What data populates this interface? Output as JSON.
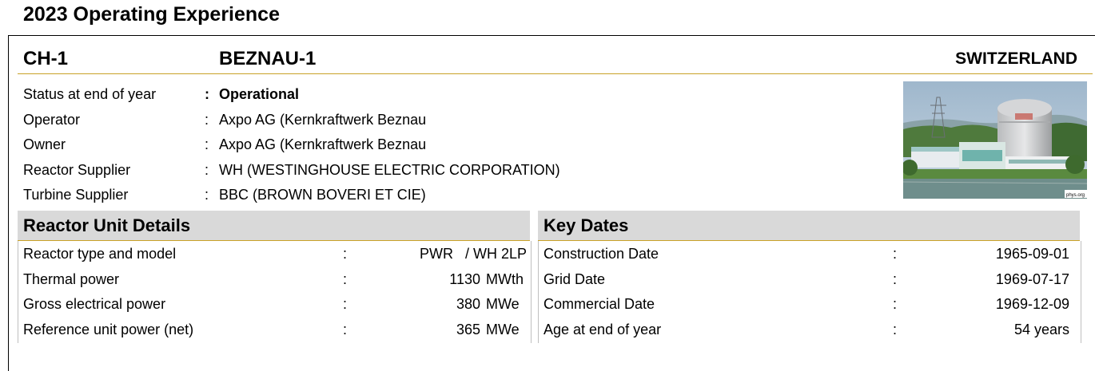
{
  "report_title": "2023 Operating Experience",
  "unit": {
    "code": "CH-1",
    "name": "BEZNAU-1",
    "country": "SWITZERLAND"
  },
  "info": [
    {
      "label": "Status at end of year",
      "value": "Operational",
      "bold": true
    },
    {
      "label": "Operator",
      "value": "Axpo AG (Kernkraftwerk Beznau"
    },
    {
      "label": "Owner",
      "value": "Axpo AG (Kernkraftwerk Beznau"
    },
    {
      "label": "Reactor Supplier",
      "value": "WH (WESTINGHOUSE ELECTRIC CORPORATION)"
    },
    {
      "label": "Turbine Supplier",
      "value": "BBC (BROWN BOVERI ET CIE)"
    }
  ],
  "photo_credit": "phys.org",
  "reactor_details": {
    "heading": "Reactor Unit Details",
    "rows": [
      {
        "label": "Reactor type and model",
        "value": "PWR   / WH 2LP",
        "unit": ""
      },
      {
        "label": "Thermal power",
        "value": "1130",
        "unit": "MWth"
      },
      {
        "label": "Gross electrical power",
        "value": "380",
        "unit": "MWe"
      },
      {
        "label": "Reference unit power (net)",
        "value": "365",
        "unit": "MWe"
      }
    ]
  },
  "key_dates": {
    "heading": "Key Dates",
    "rows": [
      {
        "label": "Construction Date",
        "value": "1965-09-01"
      },
      {
        "label": "Grid Date",
        "value": "1969-07-17"
      },
      {
        "label": "Commercial Date",
        "value": "1969-12-09"
      },
      {
        "label": "Age at end of year",
        "value": "54 years"
      }
    ]
  },
  "colon": ":",
  "colors": {
    "accent_rule": "#c9a227",
    "panel_header_bg": "#d9d9d9"
  }
}
